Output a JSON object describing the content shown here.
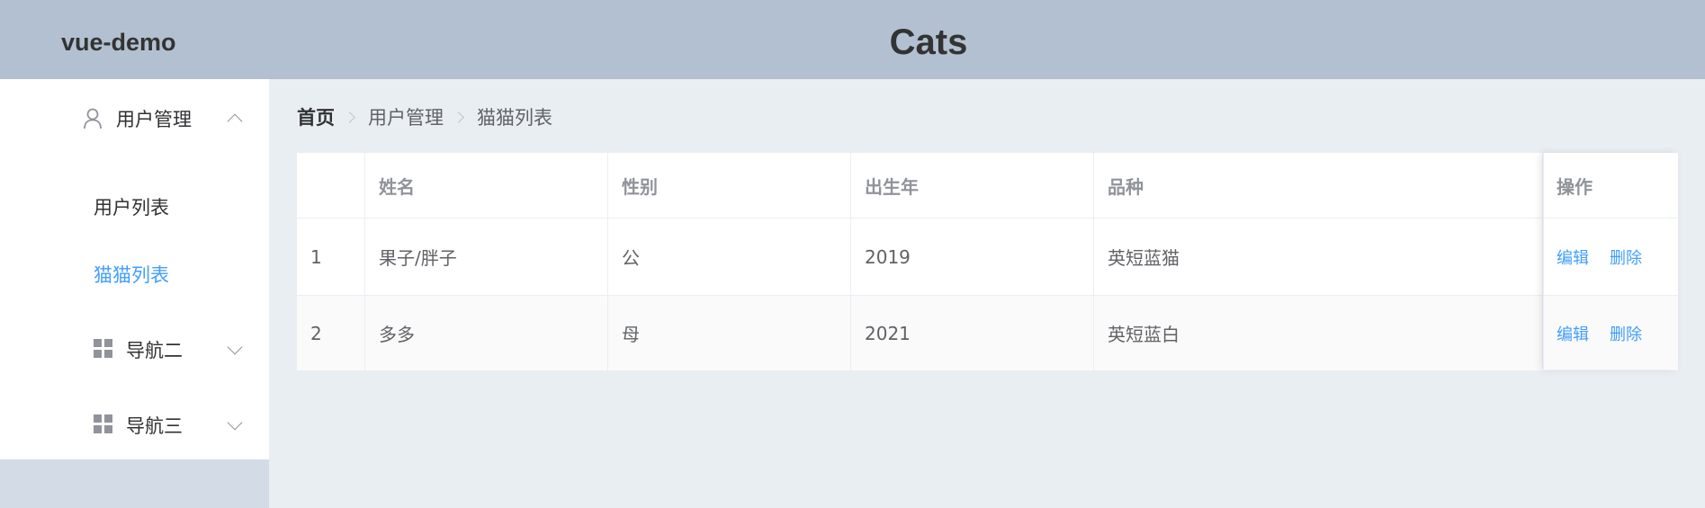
{
  "header": {
    "brand": "vue-demo",
    "title": "Cats"
  },
  "sidebar": {
    "group1": {
      "label": "用户管理",
      "icon": "user-icon",
      "expanded": true,
      "items": [
        {
          "label": "用户列表",
          "active": false
        },
        {
          "label": "猫猫列表",
          "active": true
        }
      ]
    },
    "group2": {
      "label": "导航二",
      "icon": "grid-icon",
      "expanded": false
    },
    "group3": {
      "label": "导航三",
      "icon": "grid-icon",
      "expanded": false
    }
  },
  "breadcrumb": [
    "首页",
    "用户管理",
    "猫猫列表"
  ],
  "table": {
    "columns": [
      "",
      "姓名",
      "性别",
      "出生年",
      "品种",
      "操作"
    ],
    "rows": [
      {
        "index": "1",
        "name": "果子/胖子",
        "gender": "公",
        "birth_year": "2019",
        "breed": "英短蓝猫"
      },
      {
        "index": "2",
        "name": "多多",
        "gender": "母",
        "birth_year": "2021",
        "breed": "英短蓝白"
      }
    ],
    "actions": {
      "edit": "编辑",
      "delete": "删除"
    }
  },
  "colors": {
    "header_bg": "#b3c0d1",
    "aside_bg": "#d3dce6",
    "main_bg": "#e9eef3",
    "accent": "#409eff"
  }
}
